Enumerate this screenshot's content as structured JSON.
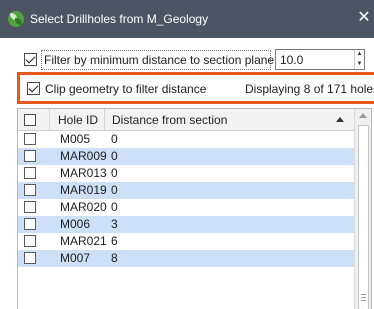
{
  "window": {
    "title": "Select Drillholes from M_Geology",
    "close_glyph": "✕",
    "icon": "leapfrog-app-icon"
  },
  "filter": {
    "checked": true,
    "label": "Filter by minimum distance to section plane",
    "value": "10.0"
  },
  "clip": {
    "checked": true,
    "label": "Clip geometry to filter distance",
    "status": "Displaying 8 of 171 holes",
    "highlight_color": "#e8581b"
  },
  "table": {
    "columns": [
      "Hole ID",
      "Distance from section"
    ],
    "sorted_column": "Distance from section",
    "sort_direction": "ascending",
    "selected_row_color": "#cde0f7",
    "rows": [
      {
        "hole_id": "M005",
        "distance": "0",
        "checked": false
      },
      {
        "hole_id": "MAR009",
        "distance": "0",
        "checked": false
      },
      {
        "hole_id": "MAR013",
        "distance": "0",
        "checked": false
      },
      {
        "hole_id": "MAR019",
        "distance": "0",
        "checked": false
      },
      {
        "hole_id": "MAR020",
        "distance": "0",
        "checked": false
      },
      {
        "hole_id": "M006",
        "distance": "3",
        "checked": false
      },
      {
        "hole_id": "MAR021",
        "distance": "6",
        "checked": false
      },
      {
        "hole_id": "M007",
        "distance": "8",
        "checked": false
      }
    ]
  }
}
